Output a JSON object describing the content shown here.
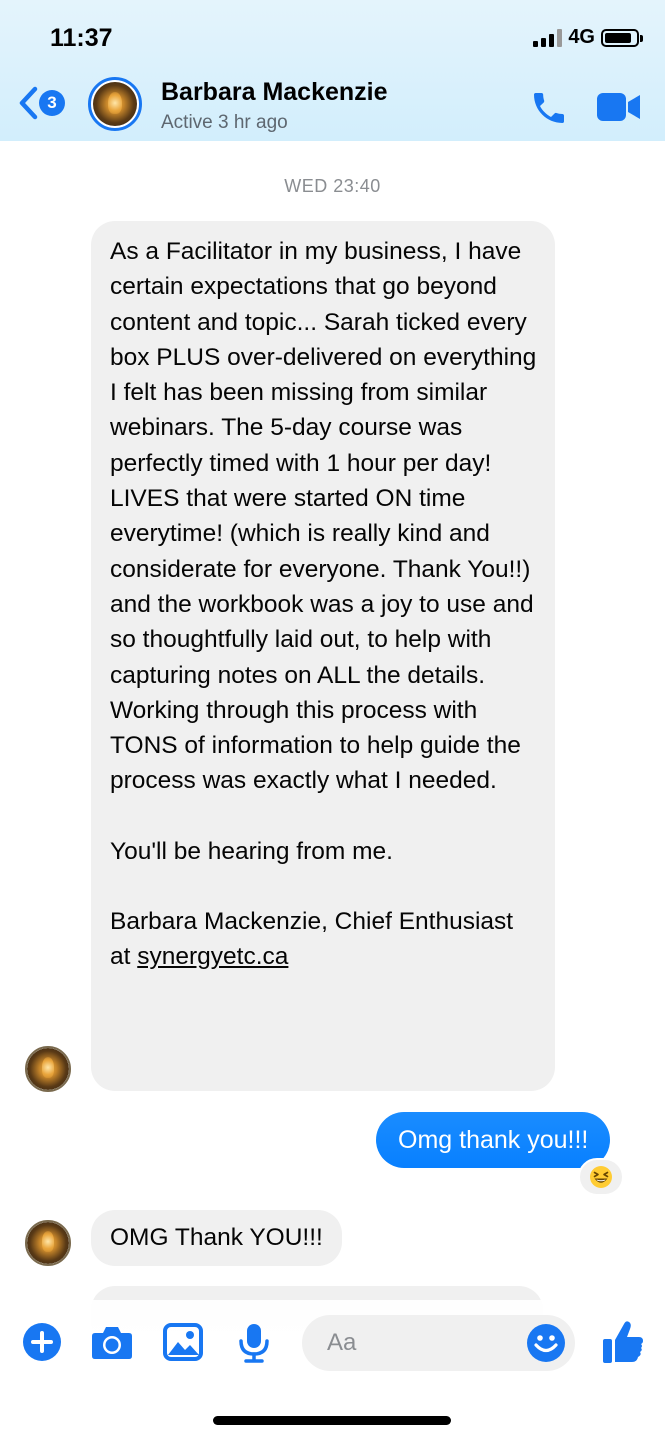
{
  "status_bar": {
    "time": "11:37",
    "network": "4G"
  },
  "header": {
    "unread_count": "3",
    "contact_name": "Barbara Mackenzie",
    "status": "Active 3 hr ago"
  },
  "thread": {
    "timestamp": "WED 23:40",
    "long_message": {
      "paragraph1": "As a Facilitator in my business, I have certain expectations that go beyond content and topic... Sarah ticked every box  PLUS over-delivered on everything I felt has been missing from similar webinars. The 5-day course was perfectly timed with 1 hour per day! LIVES that were started ON time everytime! (which is really kind and considerate for everyone. Thank You!!) and the workbook was a joy to use and so thoughtfully laid out, to help with capturing notes on ALL the details. Working through this process with TONS of information to help guide the process was exactly what I needed.",
      "paragraph2": "You'll be hearing from me.",
      "signature_prefix": "Barbara Mackenzie, Chief Enthusiast at ",
      "signature_link": "synergyetc.ca"
    },
    "outgoing_message": "Omg thank you!!!",
    "reaction_icon": "grinning-squinting-face",
    "reply_message": "OMG Thank YOU!!!"
  },
  "composer": {
    "placeholder": "Aa",
    "icons": [
      "plus-icon",
      "camera-icon",
      "image-icon",
      "microphone-icon",
      "emoji-icon",
      "thumbs-up-icon"
    ]
  },
  "colors": {
    "accent": "#1877f2",
    "outgoing_bubble": "#0a84ff",
    "incoming_bubble": "#f0f0f0"
  }
}
